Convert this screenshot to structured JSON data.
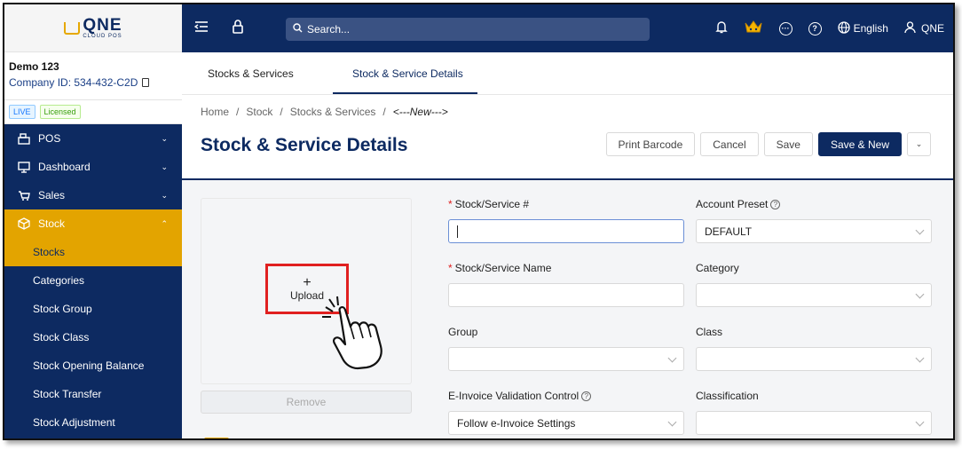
{
  "app": {
    "logo_main": "QNE",
    "logo_sub": "CLOUD POS"
  },
  "company": {
    "name": "Demo 123",
    "id_label": "Company ID: 534-432-C2D",
    "badge_live": "LIVE",
    "badge_licensed": "Licensed"
  },
  "sidebar": {
    "items": [
      {
        "label": "POS",
        "icon": "pos-register-icon",
        "chevron": "down"
      },
      {
        "label": "Dashboard",
        "icon": "dashboard-monitor-icon",
        "chevron": "down"
      },
      {
        "label": "Sales",
        "icon": "sales-cart-icon",
        "chevron": "down"
      },
      {
        "label": "Stock",
        "icon": "stock-box-icon",
        "chevron": "up",
        "active": true
      }
    ],
    "subitems": [
      {
        "label": "Stocks",
        "active": true
      },
      {
        "label": "Categories"
      },
      {
        "label": "Stock Group"
      },
      {
        "label": "Stock Class"
      },
      {
        "label": "Stock Opening Balance"
      },
      {
        "label": "Stock Transfer"
      },
      {
        "label": "Stock Adjustment"
      }
    ]
  },
  "topbar": {
    "search_placeholder": "Search...",
    "language": "English",
    "user": "QNE"
  },
  "tabs": [
    {
      "label": "Stocks & Services"
    },
    {
      "label": "Stock & Service Details",
      "active": true
    }
  ],
  "breadcrumb": {
    "items": [
      "Home",
      "Stock",
      "Stocks & Services"
    ],
    "current": "<---New--->",
    "separator": "/"
  },
  "page": {
    "title": "Stock & Service Details"
  },
  "actions": {
    "print_barcode": "Print Barcode",
    "cancel": "Cancel",
    "save": "Save",
    "save_new": "Save & New"
  },
  "upload": {
    "plus": "+",
    "label": "Upload",
    "remove": "Remove"
  },
  "form": {
    "stock_no": {
      "label": "Stock/Service #",
      "value": ""
    },
    "account_preset": {
      "label": "Account Preset",
      "value": "DEFAULT"
    },
    "stock_name": {
      "label": "Stock/Service Name",
      "value": ""
    },
    "category": {
      "label": "Category",
      "value": ""
    },
    "group": {
      "label": "Group",
      "value": ""
    },
    "class": {
      "label": "Class",
      "value": ""
    },
    "einvoice": {
      "label": "E-Invoice Validation Control",
      "value": "Follow e-Invoice Settings"
    },
    "classification": {
      "label": "Classification",
      "value": ""
    }
  },
  "colors": {
    "brand_navy": "#0d2a61",
    "accent_gold": "#e3a400",
    "highlight_red": "#e02020"
  }
}
